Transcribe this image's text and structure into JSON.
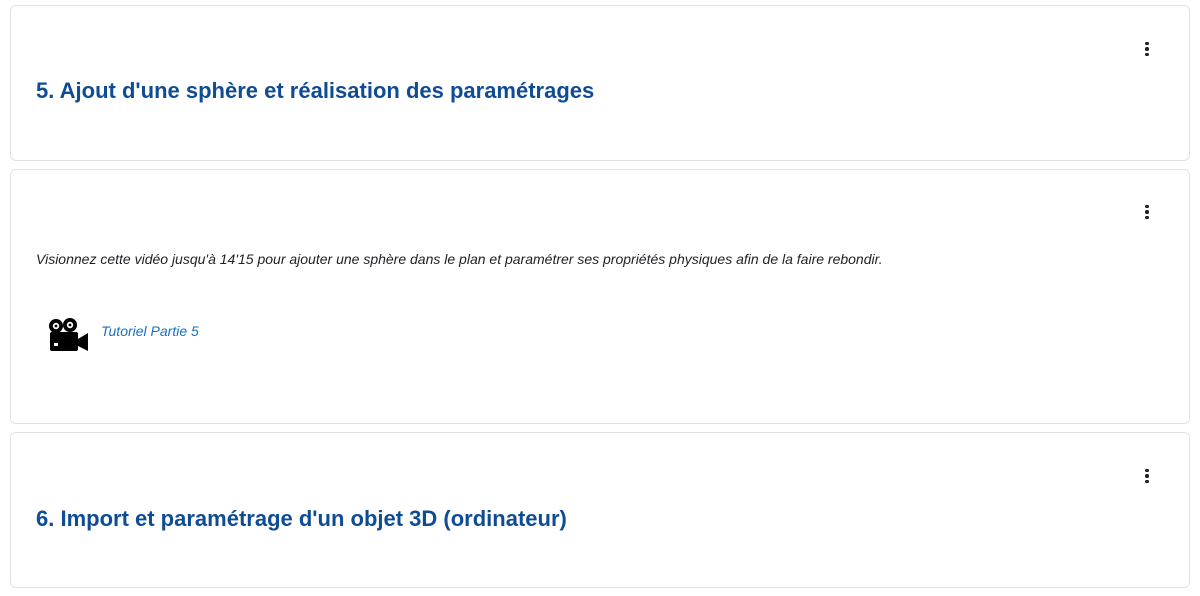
{
  "sections": [
    {
      "title": "5. Ajout d'une sphère et réalisation des paramétrages",
      "menu_icon": "vertical-ellipsis-icon"
    },
    {
      "description": "Visionnez cette vidéo jusqu'à 14'15 pour ajouter une sphère dans le plan et paramétrer ses propriétés physiques afin de la faire rebondir.",
      "activity": {
        "icon": "video-camera-icon",
        "link_label": "Tutoriel Partie 5"
      },
      "menu_icon": "vertical-ellipsis-icon"
    },
    {
      "title": "6. Import et paramétrage d'un objet 3D (ordinateur)",
      "menu_icon": "vertical-ellipsis-icon"
    }
  ],
  "colors": {
    "title": "#0f4c96",
    "link": "#1a6fc2",
    "text": "#1d2125",
    "border": "#dee2e6"
  }
}
